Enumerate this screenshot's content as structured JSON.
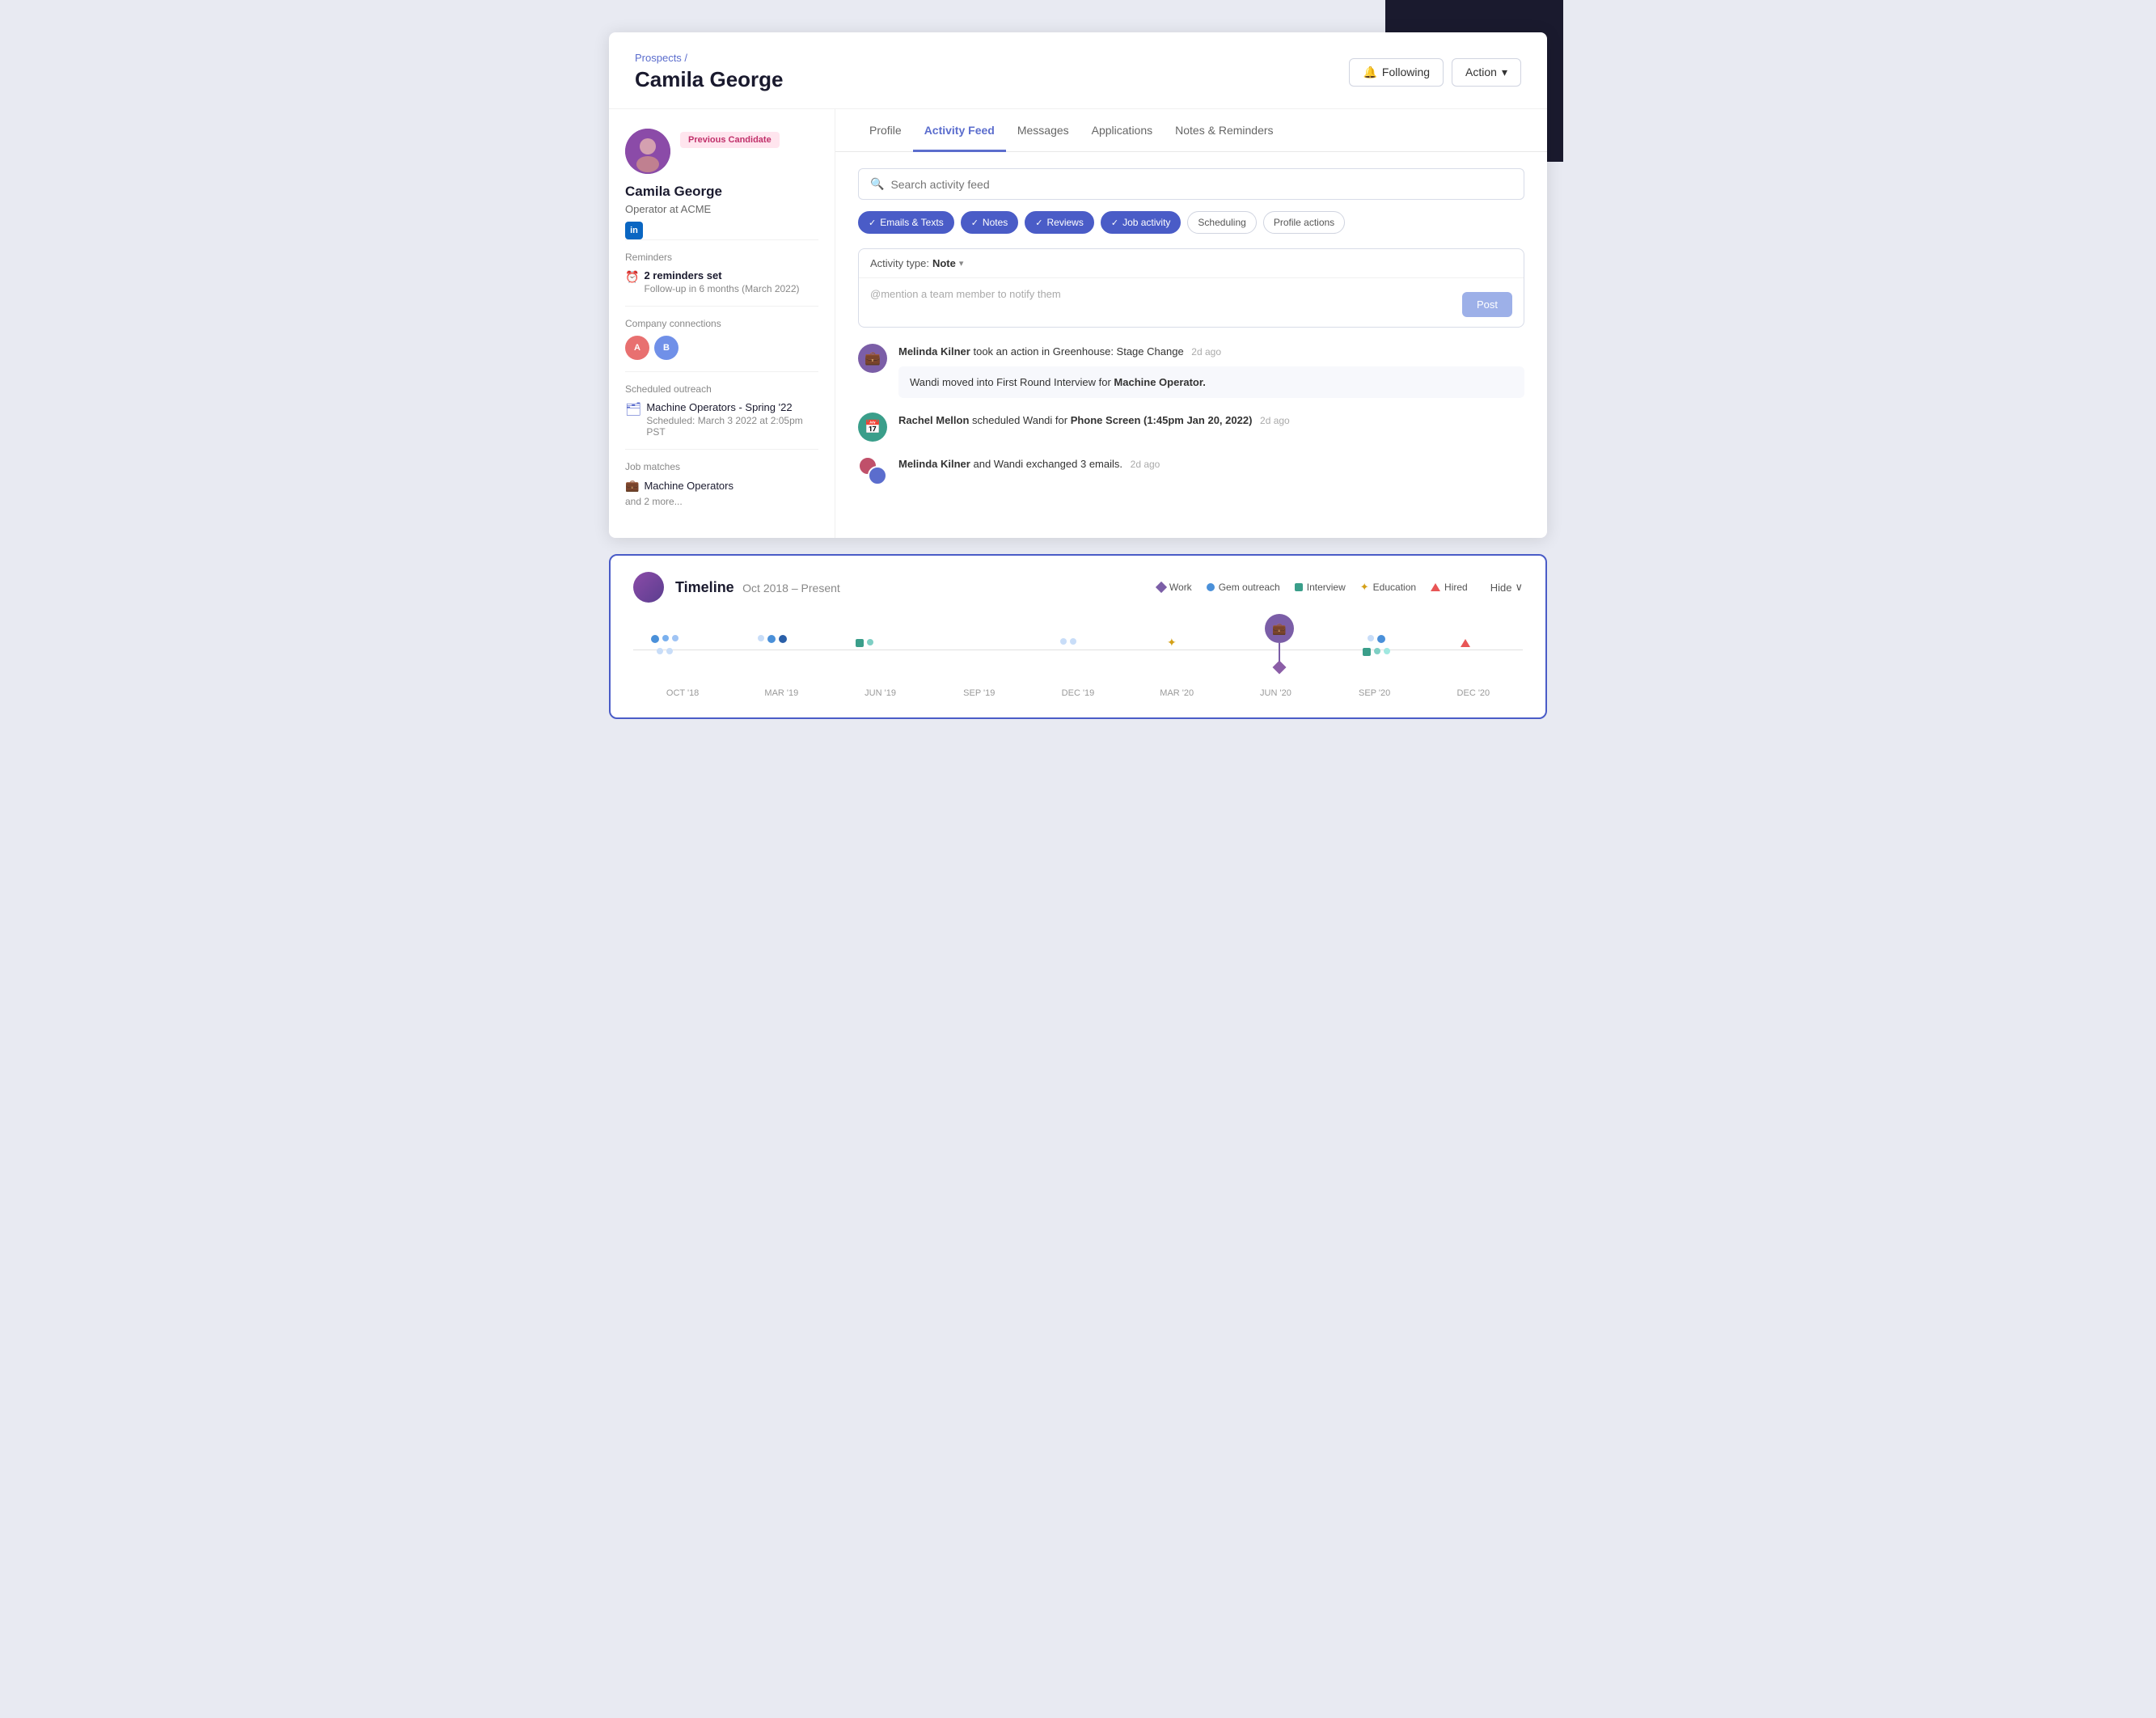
{
  "page": {
    "breadcrumb": "Prospects /",
    "title": "Camila George"
  },
  "header": {
    "following_label": "Following",
    "action_label": "Action"
  },
  "sidebar": {
    "candidate_name": "Camila George",
    "candidate_subtitle": "Operator at ACME",
    "previous_candidate_badge": "Previous Candidate",
    "sections": {
      "reminders": {
        "title": "Reminders",
        "count_label": "2 reminders set",
        "detail": "Follow-up in 6 months (March 2022)"
      },
      "company_connections": {
        "title": "Company connections"
      },
      "scheduled_outreach": {
        "title": "Scheduled outreach",
        "name": "Machine Operators - Spring '22",
        "detail": "Scheduled: March 3 2022 at 2:05pm PST"
      },
      "job_matches": {
        "title": "Job matches",
        "name": "Machine Operators",
        "more": "and 2 more..."
      }
    }
  },
  "tabs": [
    {
      "id": "profile",
      "label": "Profile",
      "active": false
    },
    {
      "id": "activity-feed",
      "label": "Activity Feed",
      "active": true
    },
    {
      "id": "messages",
      "label": "Messages",
      "active": false
    },
    {
      "id": "applications",
      "label": "Applications",
      "active": false
    },
    {
      "id": "notes-reminders",
      "label": "Notes & Reminders",
      "active": false
    }
  ],
  "activity_feed": {
    "search_placeholder": "Search activity feed",
    "filters": [
      {
        "id": "emails-texts",
        "label": "Emails & Texts",
        "active": true
      },
      {
        "id": "notes",
        "label": "Notes",
        "active": true
      },
      {
        "id": "reviews",
        "label": "Reviews",
        "active": true
      },
      {
        "id": "job-activity",
        "label": "Job activity",
        "active": true
      },
      {
        "id": "scheduling",
        "label": "Scheduling",
        "active": false
      },
      {
        "id": "profile-actions",
        "label": "Profile actions",
        "active": false
      }
    ],
    "composer": {
      "activity_type_label": "Activity type:",
      "activity_type_value": "Note",
      "placeholder": "@mention a team member to notify them",
      "post_button": "Post"
    },
    "feed_items": [
      {
        "id": "item1",
        "icon_type": "briefcase",
        "actor": "Melinda Kilner",
        "action": "took an action in Greenhouse: Stage Change",
        "time": "2d ago",
        "detail": "Wandi moved into First Round Interview for Machine Operator."
      },
      {
        "id": "item2",
        "icon_type": "calendar",
        "actor": "Rachel Mellon",
        "action": "scheduled Wandi for Phone Screen (1:45pm Jan 20, 2022)",
        "time": "2d ago",
        "detail": null
      },
      {
        "id": "item3",
        "icon_type": "multi-avatar",
        "actor": "Melinda Kilner",
        "action": "and Wandi exchanged 3 emails.",
        "time": "2d ago",
        "detail": null
      }
    ]
  },
  "timeline": {
    "title": "Timeline",
    "range": "Oct 2018 – Present",
    "legend": [
      {
        "id": "work",
        "label": "Work",
        "shape": "diamond",
        "color": "#7b5ea7"
      },
      {
        "id": "gem-outreach",
        "label": "Gem outreach",
        "shape": "dot",
        "color": "#4a90d9"
      },
      {
        "id": "interview",
        "label": "Interview",
        "shape": "square",
        "color": "#3a9e8a"
      },
      {
        "id": "education",
        "label": "Education",
        "shape": "star",
        "color": "#d4a017"
      },
      {
        "id": "hired",
        "label": "Hired",
        "shape": "triangle",
        "color": "#e85555"
      }
    ],
    "hide_label": "Hide",
    "time_labels": [
      "OCT '18",
      "MAR '19",
      "JUN '19",
      "SEP '19",
      "DEC '19",
      "MAR '20",
      "JUN '20",
      "SEP '20",
      "DEC '20"
    ]
  }
}
